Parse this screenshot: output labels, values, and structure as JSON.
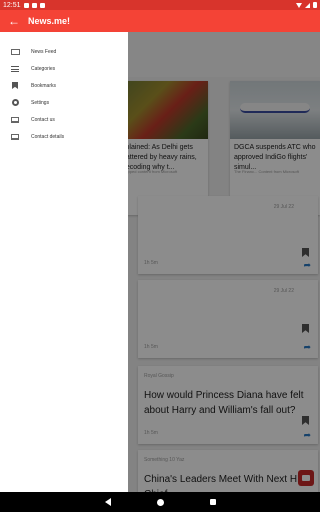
{
  "status_bar": {
    "time": "12:51"
  },
  "app_bar": {
    "title": "News.me!",
    "back_icon": "arrow-back-icon"
  },
  "drawer": {
    "items": [
      {
        "label": "News Feed",
        "icon": "news-feed-icon"
      },
      {
        "label": "Categories",
        "icon": "list-icon"
      },
      {
        "label": "Bookmarks",
        "icon": "bookmark-icon"
      },
      {
        "label": "Settings",
        "icon": "gear-icon"
      },
      {
        "label": "Contact us",
        "icon": "mail-icon"
      },
      {
        "label": "Contact details",
        "icon": "mail-icon"
      }
    ]
  },
  "background": {
    "carousel": [
      {
        "title": "xplained: As Delhi gets battered by heavy rains, decoding why t...",
        "source": "ntapped content from Microsoft"
      },
      {
        "title": "DGCA suspends ATC who approved IndiGo flights' simul...",
        "source": "The Financ... Content from Microsoft"
      }
    ],
    "cards": [
      {
        "date": "29 Jul 22",
        "meta": "1h 5m",
        "label": "",
        "title": ""
      },
      {
        "date": "29 Jul 22",
        "meta": "1h 5m",
        "label": "",
        "title": ""
      },
      {
        "date": "",
        "meta": "1h 5m",
        "label": "Royal Gossip",
        "title": "How would Princess Diana have felt about Harry and William's fall out?"
      },
      {
        "date": "",
        "meta": "",
        "label": "Something 10 Yaz",
        "title": "China's Leaders Meet With Next HK Chief"
      }
    ]
  },
  "nav_bar": {
    "back": "back-icon",
    "home": "home-icon",
    "recents": "recents-icon"
  }
}
